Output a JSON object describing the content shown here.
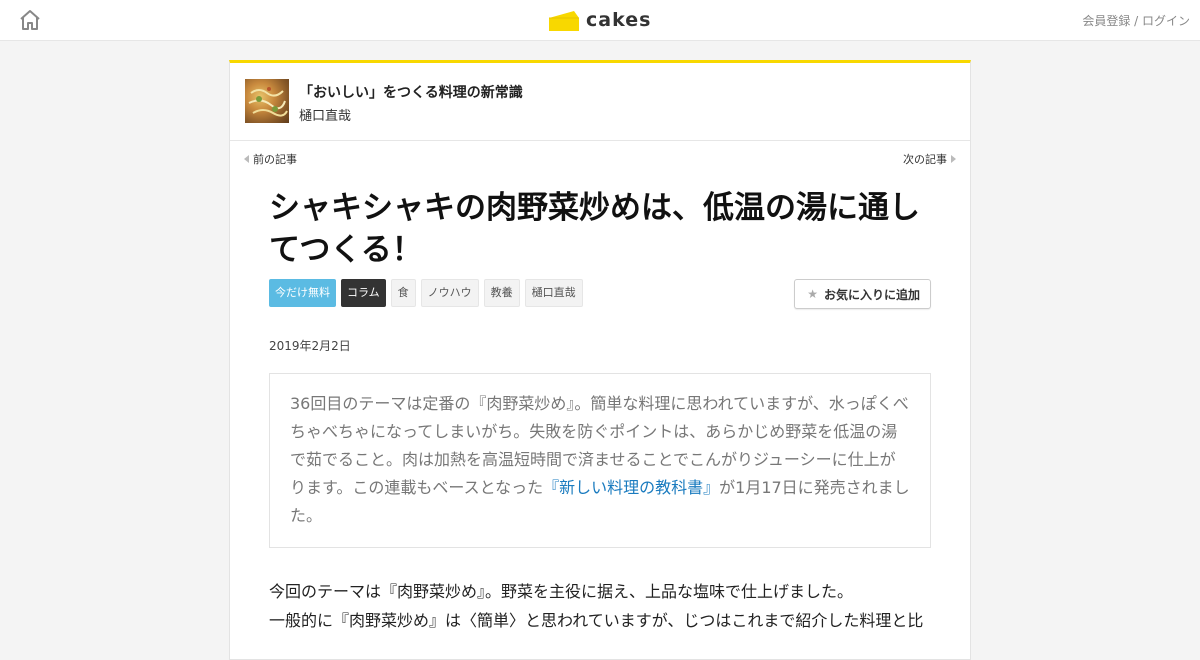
{
  "header": {
    "logo_text": "cakes",
    "login_label": "会員登録 / ログイン",
    "accent_color": "#f8d800"
  },
  "series": {
    "title": "「おいしい」をつくる料理の新常識",
    "author": "樋口直哉"
  },
  "nav": {
    "prev_label": "前の記事",
    "next_label": "次の記事"
  },
  "article": {
    "title": "シャキシャキの肉野菜炒めは、低温の湯に通してつくる！",
    "tags": [
      "今だけ無料",
      "コラム",
      "食",
      "ノウハウ",
      "教養",
      "樋口直哉"
    ],
    "favorite_label": "お気に入りに追加",
    "date": "2019年2月2日",
    "lead_before": "36回目のテーマは定番の『肉野菜炒め』。簡単な料理に思われていますが、水っぽくべちゃべちゃになってしまいがち。失敗を防ぐポイントは、あらかじめ野菜を低温の湯で茹でること。肉は加熱を高温短時間で済ませることでこんがりジューシーに仕上がります。この連載もベースとなった",
    "lead_link": "『新しい料理の教科書』",
    "lead_after": "が1月17日に発売されました。",
    "body": [
      "今回のテーマは『肉野菜炒め』。野菜を主役に据え、上品な塩味で仕上げました。",
      "一般的に『肉野菜炒め』は〈簡単〉と思われていますが、じつはこれまで紹介した料理と比"
    ]
  },
  "colors": {
    "free_tag": "#5bbbe3",
    "column_tag": "#333333",
    "link": "#1a7bbf"
  }
}
